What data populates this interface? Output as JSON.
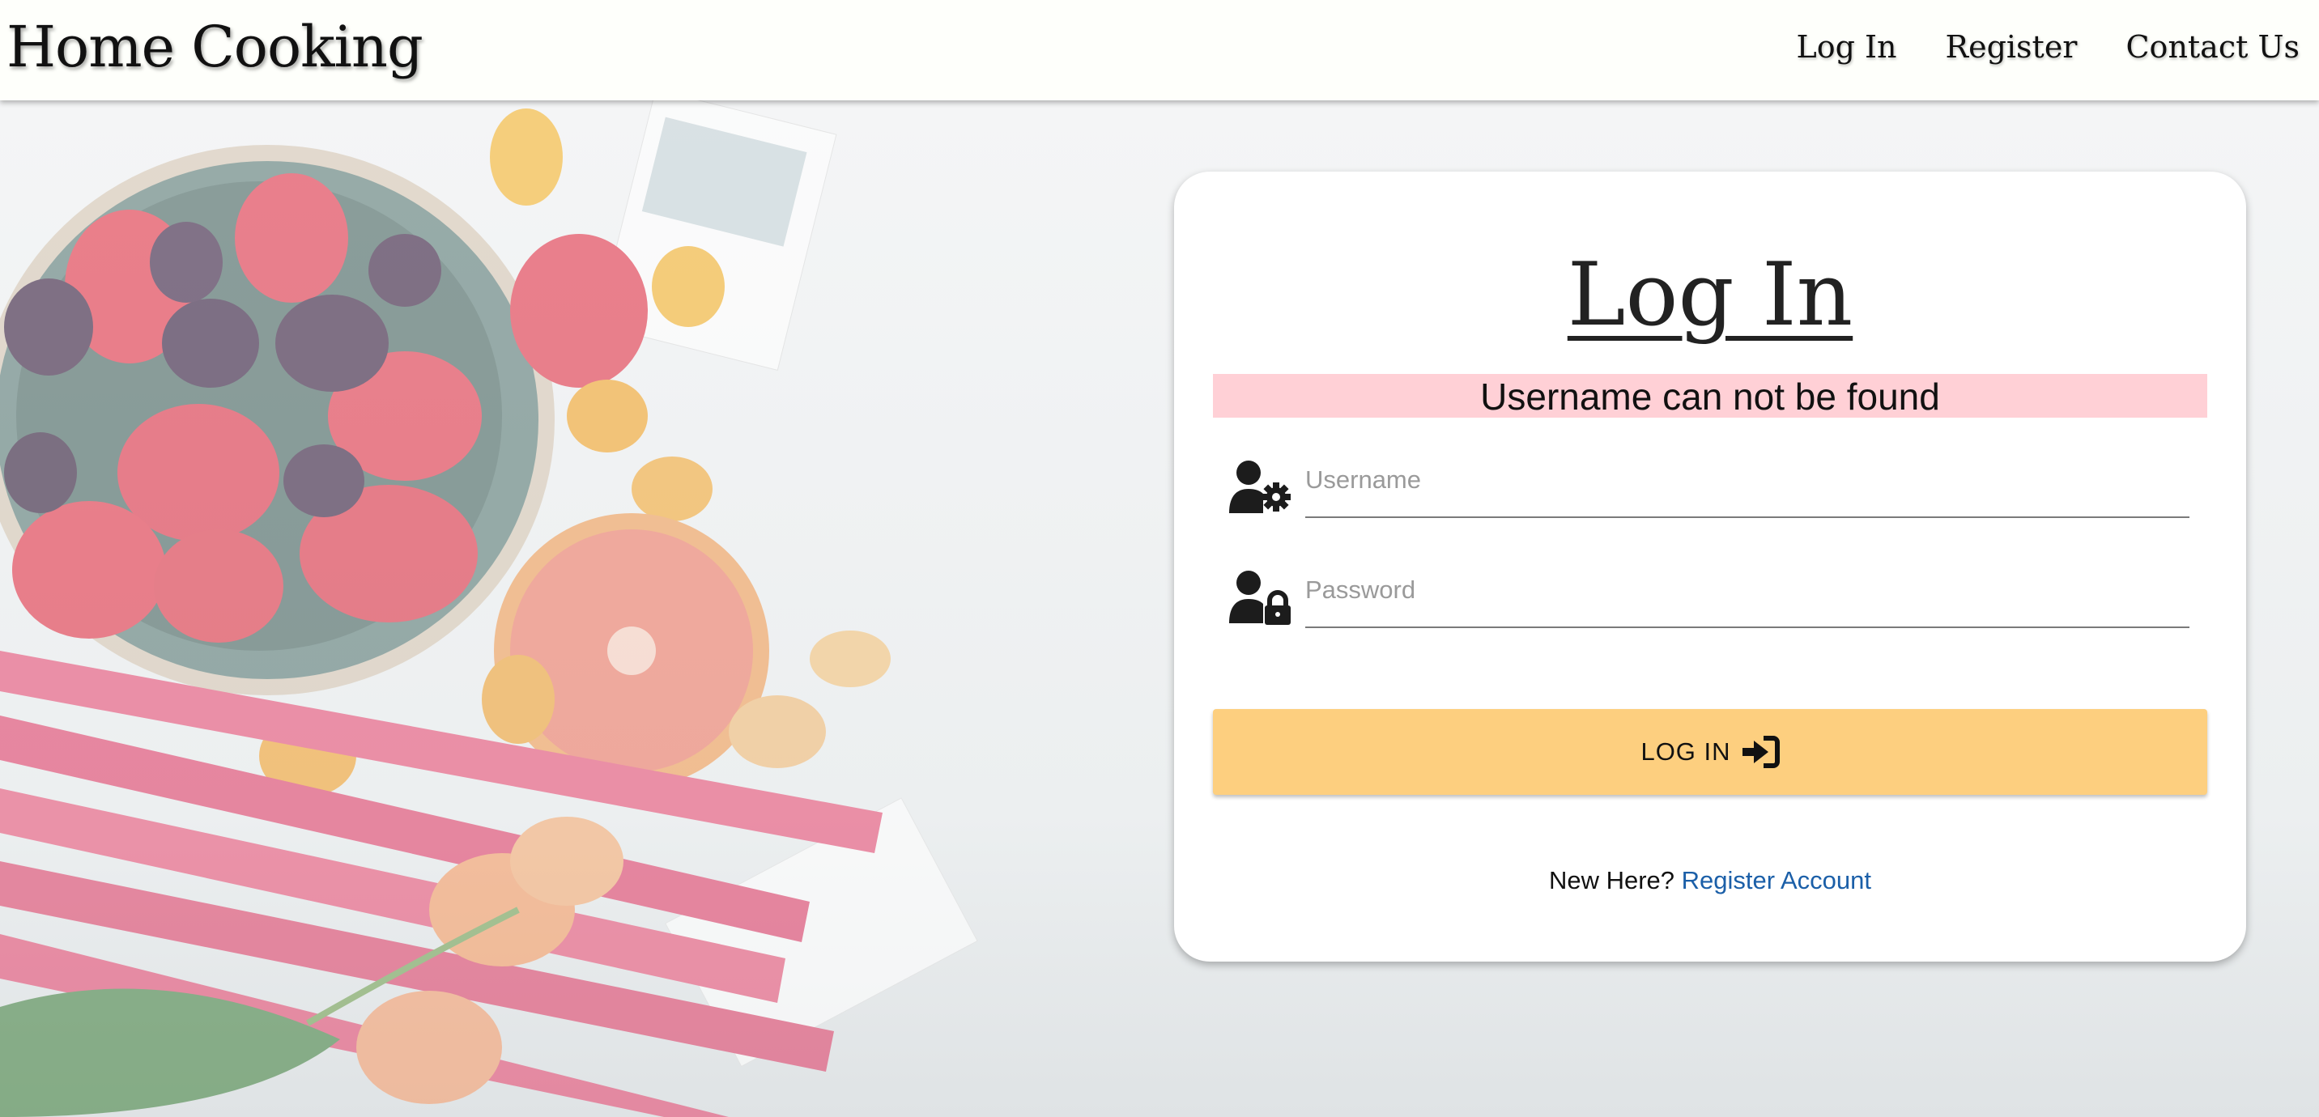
{
  "navbar": {
    "brand": "Home Cooking",
    "links": [
      {
        "label": "Log In"
      },
      {
        "label": "Register"
      },
      {
        "label": "Contact Us"
      }
    ]
  },
  "login": {
    "title": "Log In",
    "error_message": "Username can not be found",
    "username": {
      "placeholder": "Username",
      "value": "",
      "icon": "user-gear-icon"
    },
    "password": {
      "placeholder": "Password",
      "value": "",
      "icon": "user-lock-icon"
    },
    "submit_label": "LOG IN",
    "submit_icon": "sign-in-icon",
    "register_prompt": "New Here?",
    "register_link": "Register Account"
  },
  "colors": {
    "nav_background": "#fefffb",
    "error_background": "#ffd0d6",
    "button_background": "#fdcf7f",
    "link": "#1b5fa8"
  },
  "background_image": "fruit-flatlay-image"
}
